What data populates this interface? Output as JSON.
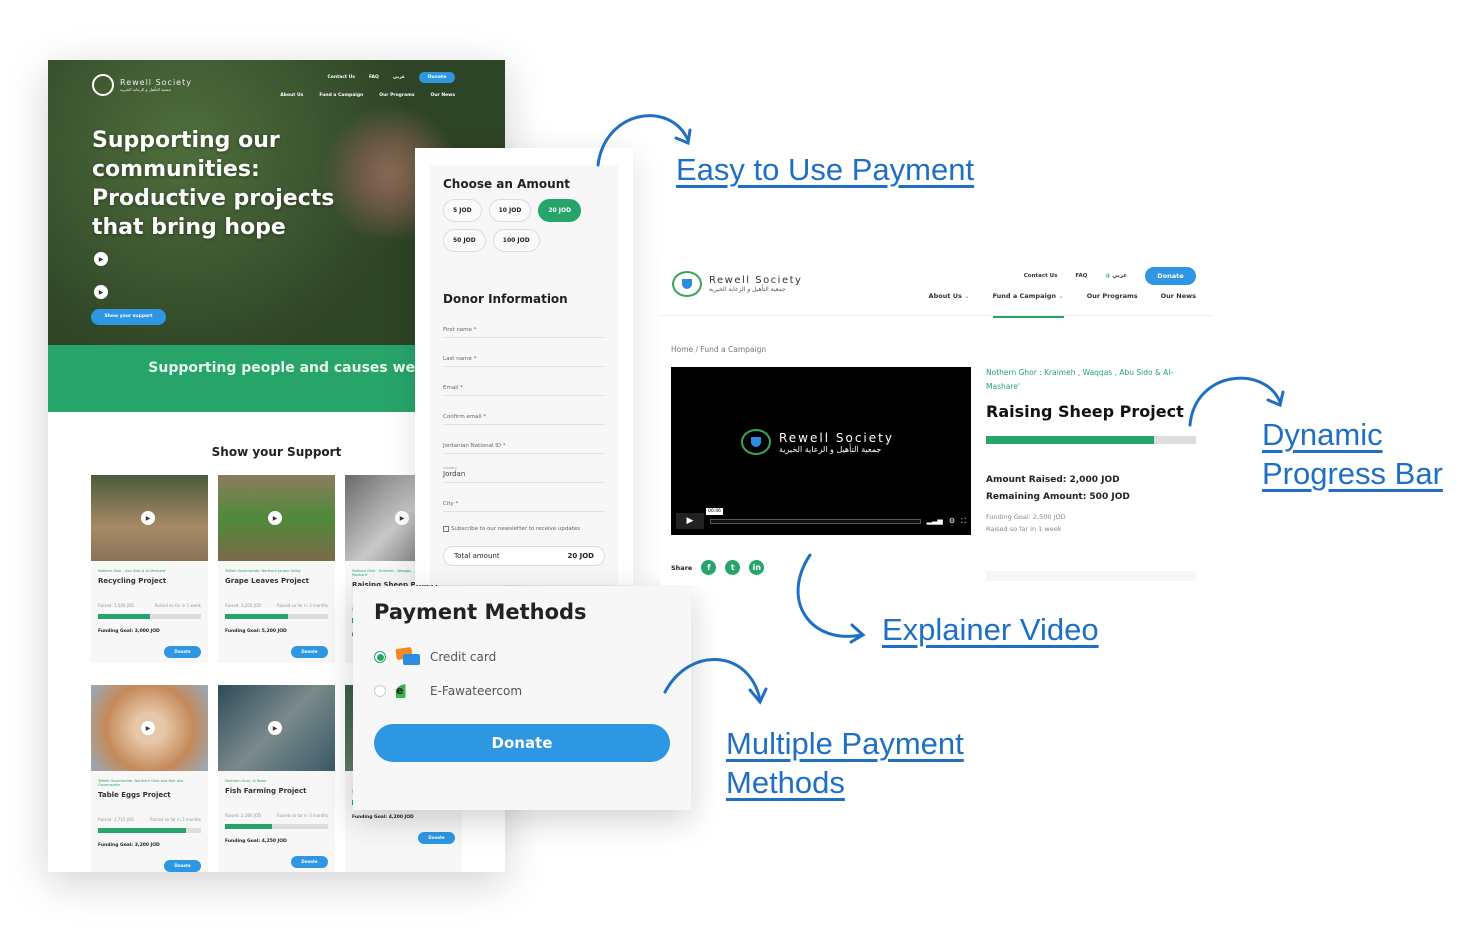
{
  "home_page": {
    "brand": "Rewell Society",
    "brand_ar": "جمعية التأهيل و الرعاية الخيرية",
    "top_nav": [
      "Contact Us",
      "FAQ",
      "عربي",
      "Donate"
    ],
    "main_nav": [
      "About Us",
      "Fund a Campaign",
      "Our Programs",
      "Our News"
    ],
    "hero_title": "Supporting our communities: Productive projects that bring hope",
    "hero_button": "Show your support",
    "band_text": "Supporting people and causes we care about",
    "section_title": "Show your Support",
    "cards": [
      {
        "location": "Nothern Ghor , Abu Sido & Al-Mashare'",
        "name": "Recycling Project",
        "raised": "Raised: 1,500 JOD",
        "period": "Raised so far in 1 week",
        "progress": 50,
        "goal": "Funding Goal: 3,000 JOD",
        "button": "Donate"
      },
      {
        "location": "Tafileh Governorate, Northern Jordan Valley",
        "name": "Grape Leaves Project",
        "raised": "Raised: 3,200 JOD",
        "period": "Raised so far in 3 months",
        "progress": 61,
        "goal": "Funding Goal: 5,200 JOD",
        "button": "Donate"
      },
      {
        "location": "Nothern Ghor : Kraimeh , Waqqas , Abu Sido & Al-Mashare'",
        "name": "Raising Sheep Project",
        "raised": "Raised: 2,000 JOD",
        "period": "Raised so far in 1 week",
        "progress": 80,
        "goal": "Funding Goal: 2,500 JOD",
        "button": "Donate"
      },
      {
        "location": "Tafileh Governorate, Northern Ghor and Deir Alla Governorate",
        "name": "Table Eggs Project",
        "raised": "Raised: 2,715 JOD",
        "period": "Raised so far in 2 months",
        "progress": 85,
        "goal": "Funding Goal: 3,200 JOD",
        "button": "Donate"
      },
      {
        "location": "Northern Ghor, Al Rowe",
        "name": "Fish Farming Project",
        "raised": "Raised: 2,380 JOD",
        "period": "Raised so far in 3 months",
        "progress": 46,
        "goal": "Funding Goal: 4,250 JOD",
        "button": "Donate"
      },
      {
        "location": "",
        "name": "",
        "raised": "Raised: 2,805 JOD",
        "period": "Raised so far in 2 months",
        "progress": 67,
        "goal": "Funding Goal: 4,200 JOD",
        "button": "Donate"
      }
    ]
  },
  "donation_form": {
    "amount_title": "Choose an Amount",
    "amounts": [
      "5 JOD",
      "10 JOD",
      "20 JOD",
      "50 JOD",
      "100 JOD"
    ],
    "selected_amount": "20 JOD",
    "donor_title": "Donor Information",
    "fields": [
      "First name",
      "Last name",
      "Email",
      "Confirm email",
      "Jordanian National ID"
    ],
    "country_label": "Country",
    "country_value": "Jordan",
    "city_label": "City",
    "required_mark": "*",
    "newsletter": "Subscribe to our newsletter to receive updates",
    "total_label": "Total amount",
    "total_value": "20 JOD"
  },
  "payment": {
    "title": "Payment Methods",
    "methods": [
      {
        "label": "Credit card",
        "selected": true,
        "icon": "credit-card-icon"
      },
      {
        "label": "E-Fawateercom",
        "selected": false,
        "icon": "efawateercom-logo-icon"
      }
    ],
    "donate_label": "Donate"
  },
  "campaign_page": {
    "brand": "Rewell Society",
    "brand_ar": "جمعية التأهيل و الرعاية الخيرية",
    "top_nav": [
      "Contact Us",
      "FAQ",
      "عربي"
    ],
    "donate_label": "Donate",
    "main_nav": [
      "About Us",
      "Fund a Campaign",
      "Our Programs",
      "Our News"
    ],
    "active_nav": "Fund a Campaign",
    "breadcrumb": [
      "Home",
      "Fund a Campaign"
    ],
    "video_time": "00:46",
    "share_label": "Share",
    "social": [
      "facebook-icon",
      "twitter-icon",
      "linkedin-icon"
    ],
    "location": "Nothern Ghor : Kraimeh , Waqqas , Abu Sido & Al-Mashare'",
    "title": "Raising Sheep Project",
    "progress_percent": 80,
    "amount_raised": "Amount Raised: 2,000 JOD",
    "remaining": "Remaining Amount: 500  JOD",
    "goal": "Funding Goal: 2,500 JOD",
    "period": "Raised so far in 1 week"
  },
  "annotations": [
    "Easy to Use Payment",
    "Dynamic Progress Bar",
    "Explainer Video",
    "Multiple Payment Methods"
  ],
  "colors": {
    "green": "#27a46a",
    "blue": "#2d97e3",
    "annotation": "#1f6fc5"
  }
}
